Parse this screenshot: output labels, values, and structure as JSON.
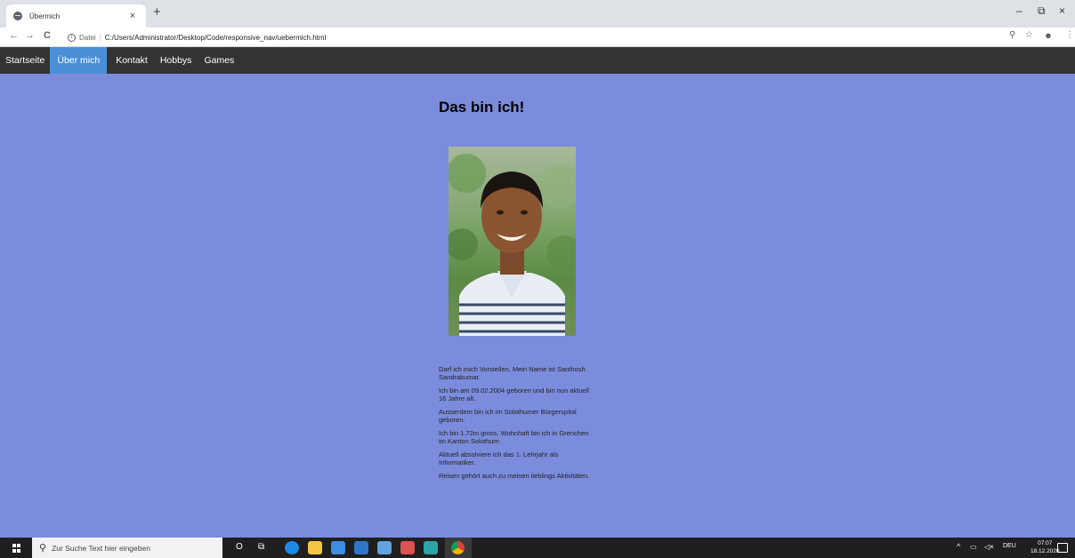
{
  "browser": {
    "tab_title": "Übermich",
    "tab_close": "×",
    "new_tab": "+",
    "back": "←",
    "forward": "→",
    "reload": "C",
    "info_glyph": "i",
    "url_scheme": "Datei",
    "url_separator": "|",
    "url": "C:/Users/Administrator/Desktop/Code/responsive_nav/uebermich.html",
    "minimize": "–",
    "maximize": "⧉",
    "close": "×",
    "zoom_glyph": "⚲",
    "star_glyph": "☆",
    "profile_glyph": "●",
    "menu_glyph": "⋮"
  },
  "nav": {
    "items": [
      {
        "label": "Startseite",
        "active": false
      },
      {
        "label": "Über mich",
        "active": true
      },
      {
        "label": "Kontakt",
        "active": false
      },
      {
        "label": "Hobbys",
        "active": false
      },
      {
        "label": "Games",
        "active": false
      }
    ]
  },
  "page": {
    "title": "Das bin ich!",
    "paragraphs": [
      "Darf ich mich Vorstellen. Mein Name ist Santhosh Sandrakumar.",
      "Ich bin am 09.02.2004 geboren und bin nun aktuell 16 Jahre alt.",
      "Ausserdem bin ich im Solothurner Bürgerspital geboren.",
      "Ich bin 1.72m gross. Wohnhaft bin ich in Grenchen im Kanton Solothurn",
      "Aktuell absolviere ich das 1. Lehrjahr als Informatiker.",
      "Reisen gehört auch zu meinen lieblings Aktivitäten."
    ]
  },
  "taskbar": {
    "search_placeholder": "Zur Suche Text hier eingeben",
    "search_glyph": "⚲",
    "cortana_glyph": "O",
    "taskview_glyph": "⧉",
    "tray_chevron": "^",
    "language": "DEU",
    "time": "07:07",
    "date": "18.12.2020"
  },
  "colors": {
    "page_background": "#7b8cdc",
    "nav_background": "#333333",
    "nav_active": "#4a90d9"
  }
}
